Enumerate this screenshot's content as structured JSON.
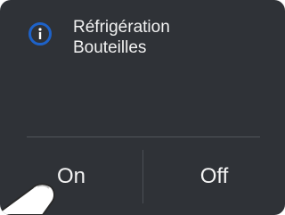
{
  "setting": {
    "title_line1": "Réfrigération",
    "title_line2": "Bouteilles",
    "info_icon": "info-icon"
  },
  "toggle": {
    "on_label": "On",
    "off_label": "Off"
  },
  "overlay": {
    "pointer": "touch-hand-icon"
  },
  "colors": {
    "panel_bg": "#2f3237",
    "accent": "#1e62c8",
    "text": "#f2f2f2",
    "divider": "#51555b"
  }
}
